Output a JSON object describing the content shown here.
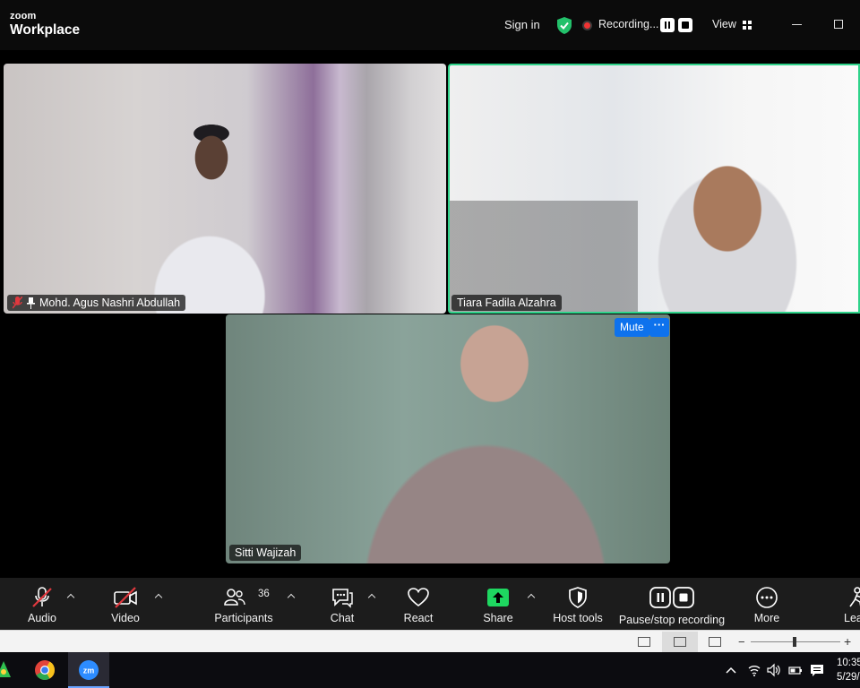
{
  "titlebar": {
    "brand_top": "zoom",
    "brand_bottom": "Workplace",
    "sign_in": "Sign in",
    "recording_label": "Recording...",
    "view_label": "View"
  },
  "participants": [
    {
      "name": "Mohd. Agus Nashri Abdullah",
      "muted": true,
      "pinned": true
    },
    {
      "name": "Tiara Fadila Alzahra",
      "active_speaker": true
    },
    {
      "name": "Sitti Wajizah"
    }
  ],
  "tile_actions": {
    "mute_label": "Mute",
    "more_label": "···"
  },
  "toolbar": {
    "audio": "Audio",
    "video": "Video",
    "participants": "Participants",
    "participants_count": "36",
    "chat": "Chat",
    "react": "React",
    "share": "Share",
    "host_tools": "Host tools",
    "record": "Pause/stop recording",
    "more": "More",
    "leave": "Leave"
  },
  "taskbar": {
    "time": "10:35",
    "date": "5/29/"
  },
  "colors": {
    "accent": "#0e72ed",
    "active_border": "#2ed38a",
    "share": "#1ed760",
    "muted": "#e0383e",
    "recording": "#e33333"
  }
}
